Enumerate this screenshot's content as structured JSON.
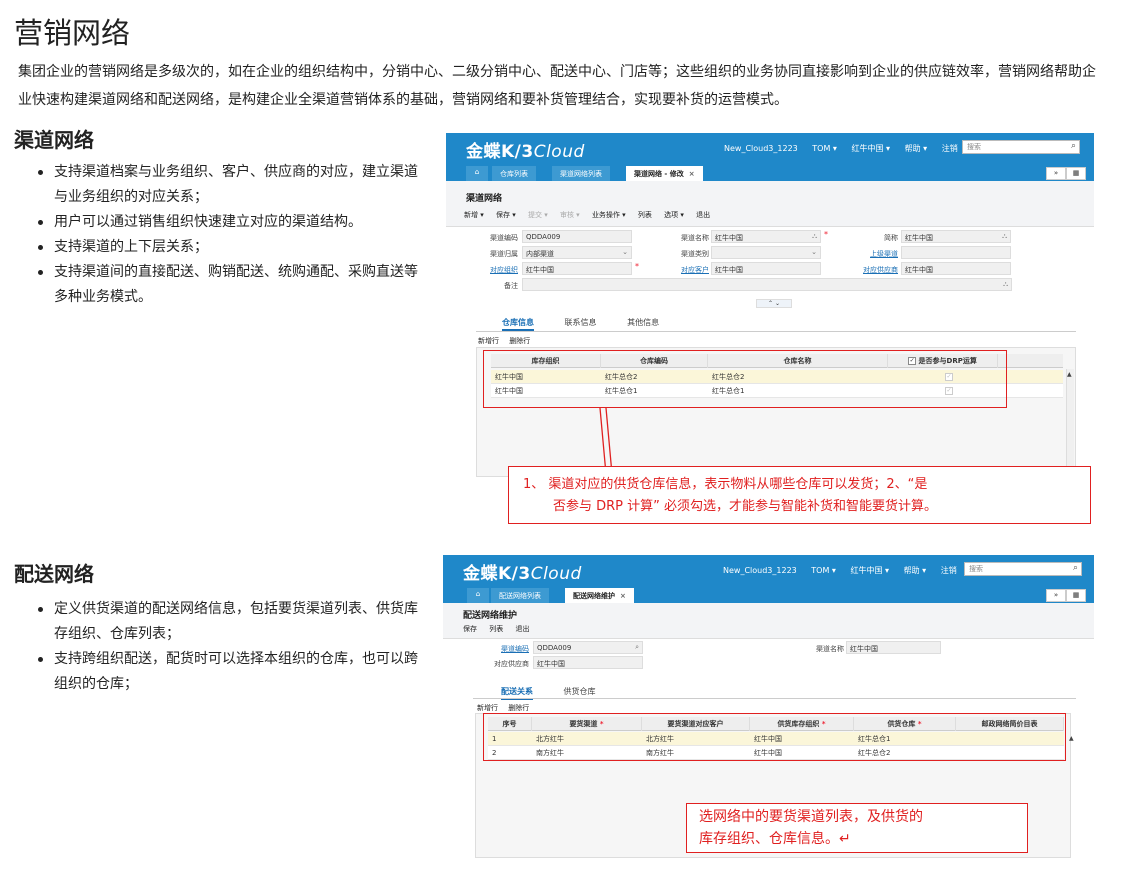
{
  "page": {
    "title": "营销网络",
    "intro": "集团企业的营销网络是多级次的，如在企业的组织结构中，分销中心、二级分销中心、配送中心、门店等；这些组织的业务协同直接影响到企业的供应链效率，营销网络帮助企业快速构建渠道网络和配送网络，是构建企业全渠道营销体系的基础，营销网络和要补货管理结合，实现要补货的运营模式。"
  },
  "section1": {
    "title": "渠道网络",
    "bullets": [
      "支持渠道档案与业务组织、客户、供应商的对应，建立渠道与业务组织的对应关系；",
      "用户可以通过销售组织快速建立对应的渠道结构。",
      "支持渠道的上下层关系；",
      "支持渠道间的直接配送、购销配送、统购通配、采购直送等多种业务模式。"
    ]
  },
  "section2": {
    "title": "配送网络",
    "bullets": [
      "定义供货渠道的配送网络信息，包括要货渠道列表、供货库存组织、仓库列表；",
      "支持跨组织配送，配货时可以选择本组织的仓库，也可以跨组织的仓库；"
    ]
  },
  "shot1": {
    "logo_main": "金蝶K/3",
    "logo_italic": "Cloud",
    "topmenu": [
      "New_Cloud3_1223",
      "TOM ▾",
      "红牛中国 ▾",
      "帮助 ▾",
      "注销"
    ],
    "search_placeholder": "搜索",
    "tabs": [
      "仓库列表",
      "渠道网络列表",
      "渠道网络 - 修改"
    ],
    "form_title": "渠道网络",
    "toolbar": [
      "新增 ▾",
      "保存 ▾",
      "提交 ▾",
      "审核 ▾",
      "业务操作 ▾",
      "列表",
      "选项 ▾",
      "退出"
    ],
    "fields": {
      "code_label": "渠道编码",
      "code_value": "QDDA009",
      "name_label": "渠道名称",
      "name_value": "红牛中国",
      "short_label": "简称",
      "short_value": "红牛中国",
      "belong_label": "渠道归属",
      "belong_value": "内部渠道",
      "type_label": "渠道类别",
      "type_value": "",
      "parent_label": "上级渠道",
      "parent_value": "",
      "org_label": "对应组织",
      "org_value": "红牛中国",
      "customer_label": "对应客户",
      "customer_value": "红牛中国",
      "supplier_label": "对应供应商",
      "supplier_value": "红牛中国",
      "remark_label": "备注",
      "remark_value": ""
    },
    "subtabs": [
      "仓库信息",
      "联系信息",
      "其他信息"
    ],
    "grid_tools": [
      "新增行",
      "删除行"
    ],
    "grid_headers": [
      "库存组织",
      "仓库编码",
      "仓库名称",
      "是否参与DRP运算"
    ],
    "grid_rows": [
      {
        "org": "红牛中国",
        "code": "红牛总仓2",
        "name": "红牛总仓2"
      },
      {
        "org": "红牛中国",
        "code": "红牛总仓1",
        "name": "红牛总仓1"
      }
    ]
  },
  "callout1": {
    "line1": "1、 渠道对应的供货仓库信息，表示物料从哪些仓库可以发货；2、“是",
    "line2": "否参与 DRP 计算” 必须勾选，才能参与智能补货和智能要货计算。"
  },
  "shot2": {
    "logo_main": "金蝶K/3",
    "logo_italic": "Cloud",
    "topmenu": [
      "New_Cloud3_1223",
      "TOM ▾",
      "红牛中国 ▾",
      "帮助 ▾",
      "注销"
    ],
    "search_placeholder": "搜索",
    "tabs": [
      "配送网络列表",
      "配送网络维护"
    ],
    "form_title": "配送网络维护",
    "toolbar": [
      "保存",
      "列表",
      "退出"
    ],
    "fields": {
      "code_label": "渠道编码",
      "code_value": "QDDA009",
      "name_label": "渠道名称",
      "name_value": "红牛中国",
      "supplier_label": "对应供应商",
      "supplier_value": "红牛中国"
    },
    "subtabs": [
      "配送关系",
      "供货仓库"
    ],
    "grid_tools": [
      "新增行",
      "删除行"
    ],
    "grid_headers": [
      "序号",
      "要货渠道",
      "要货渠道对应客户",
      "供货库存组织",
      "供货仓库",
      "邮政网络简价目表"
    ],
    "grid_rows": [
      {
        "seq": "1",
        "channel": "北方红牛",
        "customer": "北方红牛",
        "org": "红牛中国",
        "wh": "红牛总仓1",
        "price": ""
      },
      {
        "seq": "2",
        "channel": "南方红牛",
        "customer": "南方红牛",
        "org": "红牛中国",
        "wh": "红牛总仓2",
        "price": ""
      }
    ]
  },
  "callout2": {
    "line1": "选网络中的要货渠道列表，及供货的",
    "line2": "库存组织、仓库信息。↵"
  }
}
